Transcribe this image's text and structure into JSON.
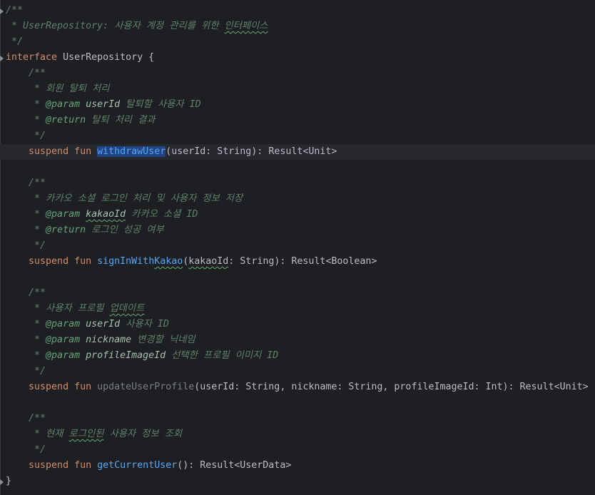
{
  "editor": {
    "lines": [
      [
        {
          "t": "/**",
          "c": "doc"
        }
      ],
      [
        {
          "t": " * UserRepository: 사용자 계정 관리를 위한 ",
          "c": "doc"
        },
        {
          "t": "인터페이스",
          "c": "doc typo"
        }
      ],
      [
        {
          "t": " */",
          "c": "doc"
        }
      ],
      [
        {
          "t": "interface",
          "c": "kw"
        },
        {
          "t": " UserRepository {",
          "c": "plain"
        }
      ],
      [
        {
          "t": "    /**",
          "c": "doc"
        }
      ],
      [
        {
          "t": "     * 회원 탈퇴 처리",
          "c": "doc"
        }
      ],
      [
        {
          "t": "     * ",
          "c": "doc"
        },
        {
          "t": "@param",
          "c": "tag"
        },
        {
          "t": " ",
          "c": "doc"
        },
        {
          "t": "userId",
          "c": "pname"
        },
        {
          "t": " 탈퇴할 사용자 ID",
          "c": "doc"
        }
      ],
      [
        {
          "t": "     * ",
          "c": "doc"
        },
        {
          "t": "@return",
          "c": "tag"
        },
        {
          "t": " 탈퇴 처리 결과",
          "c": "doc"
        }
      ],
      [
        {
          "t": "     */",
          "c": "doc"
        }
      ],
      [
        {
          "t": "    ",
          "c": "plain"
        },
        {
          "t": "suspend",
          "c": "kw"
        },
        {
          "t": " ",
          "c": "plain"
        },
        {
          "t": "fun",
          "c": "kw"
        },
        {
          "t": " ",
          "c": "plain"
        },
        {
          "t": "withdrawUser",
          "c": "fn sel"
        },
        {
          "t": "(userId: String): Result<Unit>",
          "c": "plain"
        }
      ],
      [],
      [
        {
          "t": "    /**",
          "c": "doc"
        }
      ],
      [
        {
          "t": "     * 카카오 소셜 로그인 처리 및 사용자 정보 저장",
          "c": "doc"
        }
      ],
      [
        {
          "t": "     * ",
          "c": "doc"
        },
        {
          "t": "@param",
          "c": "tag"
        },
        {
          "t": " ",
          "c": "doc"
        },
        {
          "t": "kakaoId",
          "c": "pname typo"
        },
        {
          "t": " 카카오 소셜 ID",
          "c": "doc"
        }
      ],
      [
        {
          "t": "     * ",
          "c": "doc"
        },
        {
          "t": "@return",
          "c": "tag"
        },
        {
          "t": " 로그인 성공 여부",
          "c": "doc"
        }
      ],
      [
        {
          "t": "     */",
          "c": "doc"
        }
      ],
      [
        {
          "t": "    ",
          "c": "plain"
        },
        {
          "t": "suspend",
          "c": "kw"
        },
        {
          "t": " ",
          "c": "plain"
        },
        {
          "t": "fun",
          "c": "kw"
        },
        {
          "t": " ",
          "c": "plain"
        },
        {
          "t": "signInWith",
          "c": "fn"
        },
        {
          "t": "Kakao",
          "c": "fn typo"
        },
        {
          "t": "(",
          "c": "plain"
        },
        {
          "t": "kakaoId",
          "c": "plain typo"
        },
        {
          "t": ": String): Result<Boolean>",
          "c": "plain"
        }
      ],
      [],
      [
        {
          "t": "    /**",
          "c": "doc"
        }
      ],
      [
        {
          "t": "     * 사용자 프로필 ",
          "c": "doc"
        },
        {
          "t": "업데이트",
          "c": "doc typo"
        }
      ],
      [
        {
          "t": "     * ",
          "c": "doc"
        },
        {
          "t": "@param",
          "c": "tag"
        },
        {
          "t": " ",
          "c": "doc"
        },
        {
          "t": "userId",
          "c": "pname"
        },
        {
          "t": " 사용자 ID",
          "c": "doc"
        }
      ],
      [
        {
          "t": "     * ",
          "c": "doc"
        },
        {
          "t": "@param",
          "c": "tag"
        },
        {
          "t": " ",
          "c": "doc"
        },
        {
          "t": "nickname",
          "c": "pname"
        },
        {
          "t": " 변경할 닉네임",
          "c": "doc"
        }
      ],
      [
        {
          "t": "     * ",
          "c": "doc"
        },
        {
          "t": "@param",
          "c": "tag"
        },
        {
          "t": " ",
          "c": "doc"
        },
        {
          "t": "profileImageId",
          "c": "pname"
        },
        {
          "t": " 선택한 프로필 이미지 ID",
          "c": "doc"
        }
      ],
      [
        {
          "t": "     */",
          "c": "doc"
        }
      ],
      [
        {
          "t": "    ",
          "c": "plain"
        },
        {
          "t": "suspend",
          "c": "kw"
        },
        {
          "t": " ",
          "c": "plain"
        },
        {
          "t": "fun",
          "c": "kw"
        },
        {
          "t": " ",
          "c": "plain"
        },
        {
          "t": "updateUserProfile",
          "c": "fn-unused"
        },
        {
          "t": "(userId: String, nickname: String, profileImageId: Int): Result<Unit>",
          "c": "plain"
        }
      ],
      [],
      [
        {
          "t": "    /**",
          "c": "doc"
        }
      ],
      [
        {
          "t": "     * 현재 ",
          "c": "doc"
        },
        {
          "t": "로그인된",
          "c": "doc typo"
        },
        {
          "t": " 사용자 정보 조회",
          "c": "doc"
        }
      ],
      [
        {
          "t": "     */",
          "c": "doc"
        }
      ],
      [
        {
          "t": "    ",
          "c": "plain"
        },
        {
          "t": "suspend",
          "c": "kw"
        },
        {
          "t": " ",
          "c": "plain"
        },
        {
          "t": "fun",
          "c": "kw"
        },
        {
          "t": " ",
          "c": "plain"
        },
        {
          "t": "getCurrentUser",
          "c": "fn"
        },
        {
          "t": "(): Result<UserData>",
          "c": "plain"
        }
      ],
      [
        {
          "t": "}",
          "c": "plain"
        }
      ]
    ],
    "current_line": 9,
    "fold_markers": [
      0,
      3,
      30
    ]
  }
}
